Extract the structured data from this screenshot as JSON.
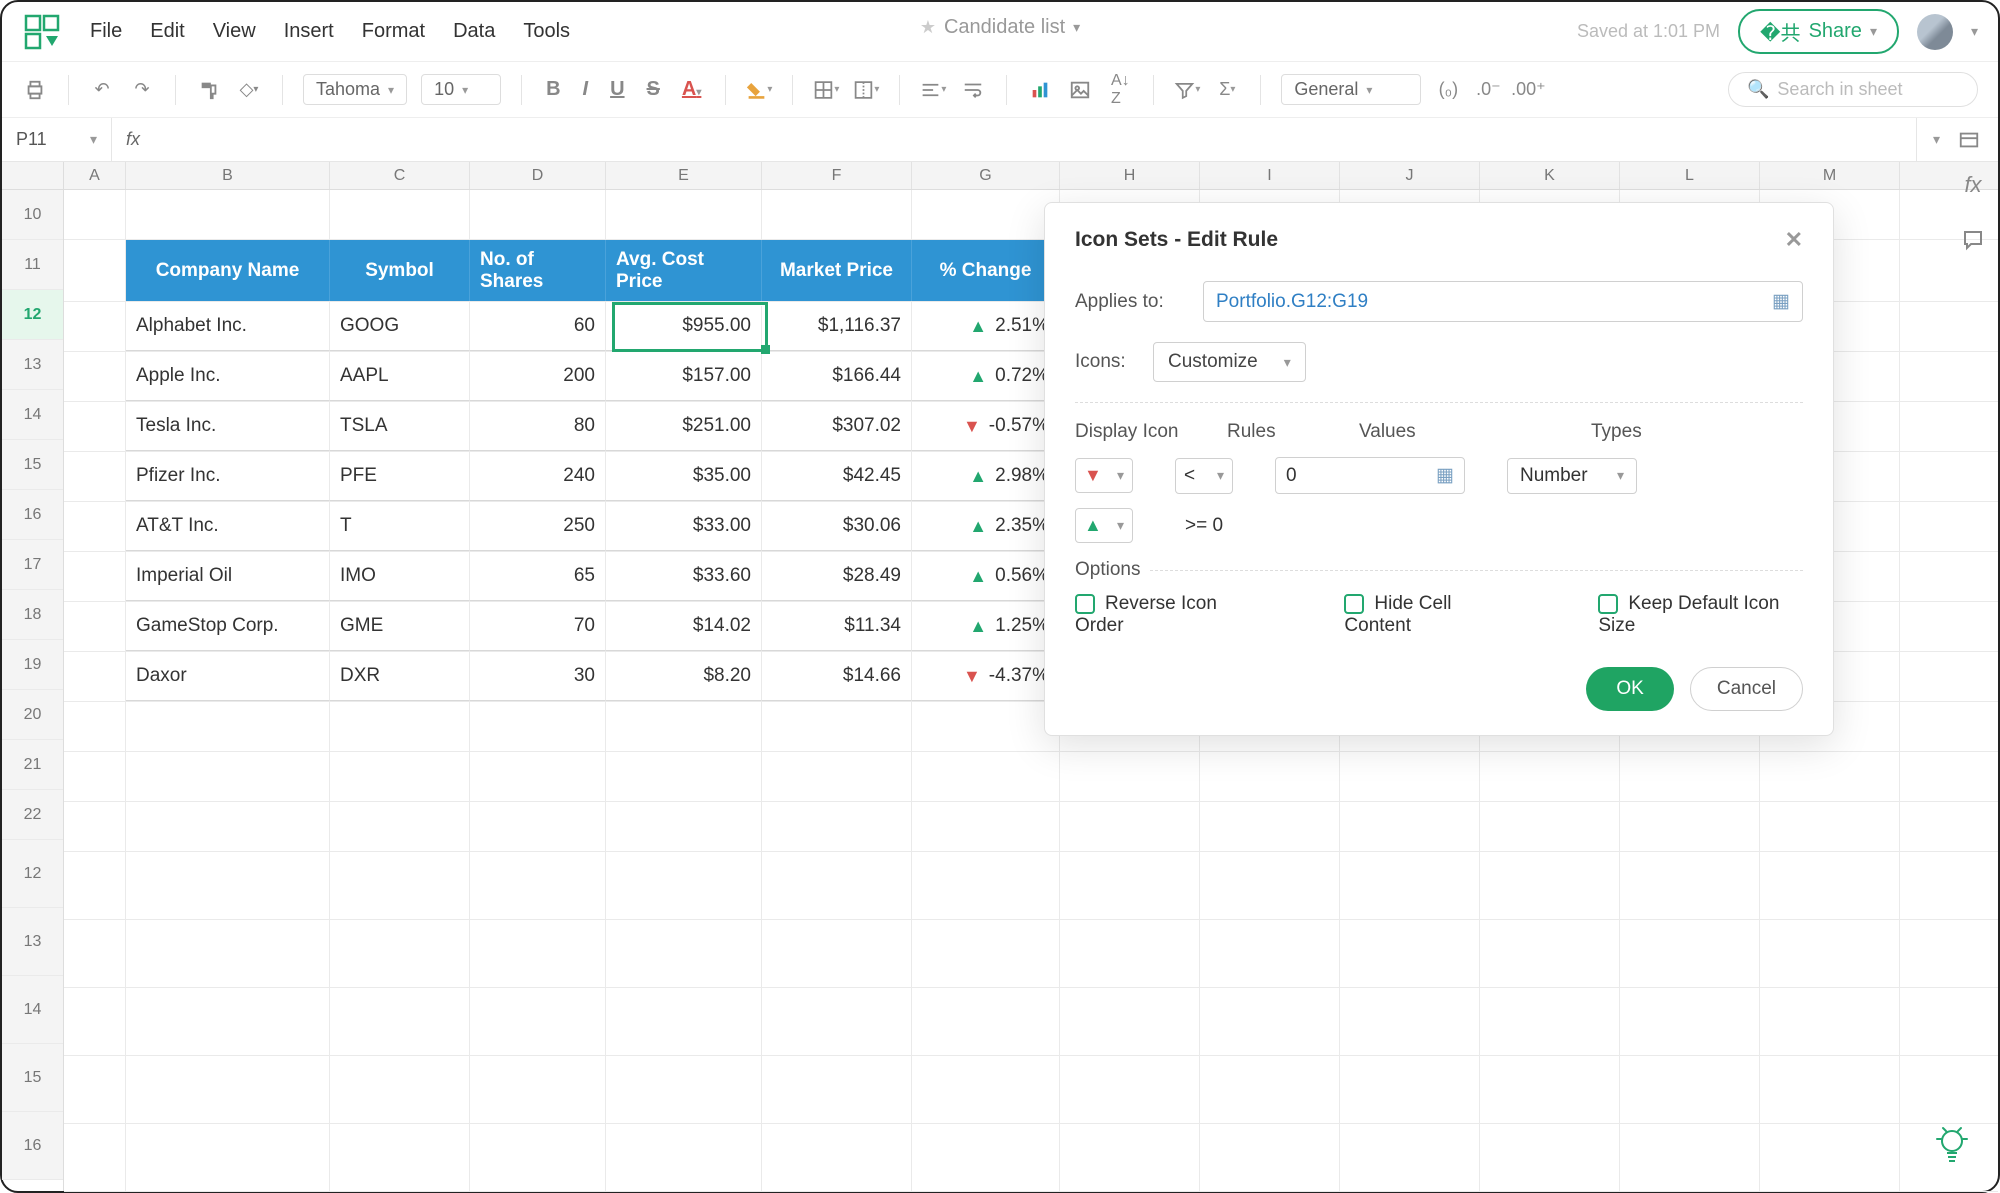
{
  "doc": {
    "title": "Candidate list"
  },
  "menu": {
    "file": "File",
    "edit": "Edit",
    "view": "View",
    "insert": "Insert",
    "format": "Format",
    "data": "Data",
    "tools": "Tools"
  },
  "status": {
    "saved": "Saved at 1:01 PM"
  },
  "share": {
    "label": "Share"
  },
  "toolbar": {
    "font": "Tahoma",
    "size": "10",
    "numfmt": "General",
    "search_placeholder": "Search in sheet"
  },
  "namebox": "P11",
  "columns": [
    "A",
    "B",
    "C",
    "D",
    "E",
    "F",
    "G",
    "H",
    "I",
    "J",
    "K",
    "L",
    "M"
  ],
  "row_numbers_a": [
    "10",
    "11",
    "12",
    "13",
    "14",
    "15",
    "16",
    "17",
    "18",
    "19",
    "20",
    "21",
    "22"
  ],
  "row_numbers_b": [
    "12",
    "13",
    "14",
    "15",
    "16"
  ],
  "selected_row_index": 2,
  "table": {
    "headers": [
      "Company Name",
      "Symbol",
      "No. of Shares",
      "Avg. Cost Price",
      "Market Price",
      "% Change"
    ],
    "rows": [
      {
        "company": "Alphabet Inc.",
        "symbol": "GOOG",
        "shares": "60",
        "cost": "$955.00",
        "price": "$1,116.37",
        "dir": "up",
        "chg": "2.51%"
      },
      {
        "company": "Apple Inc.",
        "symbol": "AAPL",
        "shares": "200",
        "cost": "$157.00",
        "price": "$166.44",
        "dir": "up",
        "chg": "0.72%"
      },
      {
        "company": "Tesla Inc.",
        "symbol": "TSLA",
        "shares": "80",
        "cost": "$251.00",
        "price": "$307.02",
        "dir": "down",
        "chg": "-0.57%"
      },
      {
        "company": "Pfizer Inc.",
        "symbol": "PFE",
        "shares": "240",
        "cost": "$35.00",
        "price": "$42.45",
        "dir": "up",
        "chg": "2.98%"
      },
      {
        "company": "AT&T Inc.",
        "symbol": "T",
        "shares": "250",
        "cost": "$33.00",
        "price": "$30.06",
        "dir": "up",
        "chg": "2.35%"
      },
      {
        "company": "Imperial Oil",
        "symbol": "IMO",
        "shares": "65",
        "cost": "$33.60",
        "price": "$28.49",
        "dir": "up",
        "chg": "0.56%"
      },
      {
        "company": "GameStop Corp.",
        "symbol": "GME",
        "shares": "70",
        "cost": "$14.02",
        "price": "$11.34",
        "dir": "up",
        "chg": "1.25%"
      },
      {
        "company": "Daxor",
        "symbol": "DXR",
        "shares": "30",
        "cost": "$8.20",
        "price": "$14.66",
        "dir": "down",
        "chg": "-4.37%"
      }
    ]
  },
  "dialog": {
    "title": "Icon Sets - Edit Rule",
    "applies_label": "Applies to:",
    "applies_value": "Portfolio.G12:G19",
    "icons_label": "Icons:",
    "icons_value": "Customize",
    "cols": {
      "display": "Display Icon",
      "rules": "Rules",
      "values": "Values",
      "types": "Types"
    },
    "rules": [
      {
        "icon": "down",
        "op": "<",
        "value": "0",
        "type": "Number"
      },
      {
        "icon": "up",
        "op": ">=",
        "value": "0",
        "type": ""
      }
    ],
    "options_label": "Options",
    "opt1": "Reverse Icon Order",
    "opt2": "Hide Cell Content",
    "opt3": "Keep Default Icon Size",
    "ok": "OK",
    "cancel": "Cancel"
  },
  "chart_data": {
    "type": "table",
    "title": "Portfolio",
    "columns": [
      "Company Name",
      "Symbol",
      "No. of Shares",
      "Avg. Cost Price",
      "Market Price",
      "% Change"
    ],
    "rows": [
      [
        "Alphabet Inc.",
        "GOOG",
        60,
        955.0,
        1116.37,
        2.51
      ],
      [
        "Apple Inc.",
        "AAPL",
        200,
        157.0,
        166.44,
        0.72
      ],
      [
        "Tesla Inc.",
        "TSLA",
        80,
        251.0,
        307.02,
        -0.57
      ],
      [
        "Pfizer Inc.",
        "PFE",
        240,
        35.0,
        42.45,
        2.98
      ],
      [
        "AT&T Inc.",
        "T",
        250,
        33.0,
        30.06,
        2.35
      ],
      [
        "Imperial Oil",
        "IMO",
        65,
        33.6,
        28.49,
        0.56
      ],
      [
        "GameStop Corp.",
        "GME",
        70,
        14.02,
        11.34,
        1.25
      ],
      [
        "Daxor",
        "DXR",
        30,
        8.2,
        14.66,
        -4.37
      ]
    ]
  }
}
